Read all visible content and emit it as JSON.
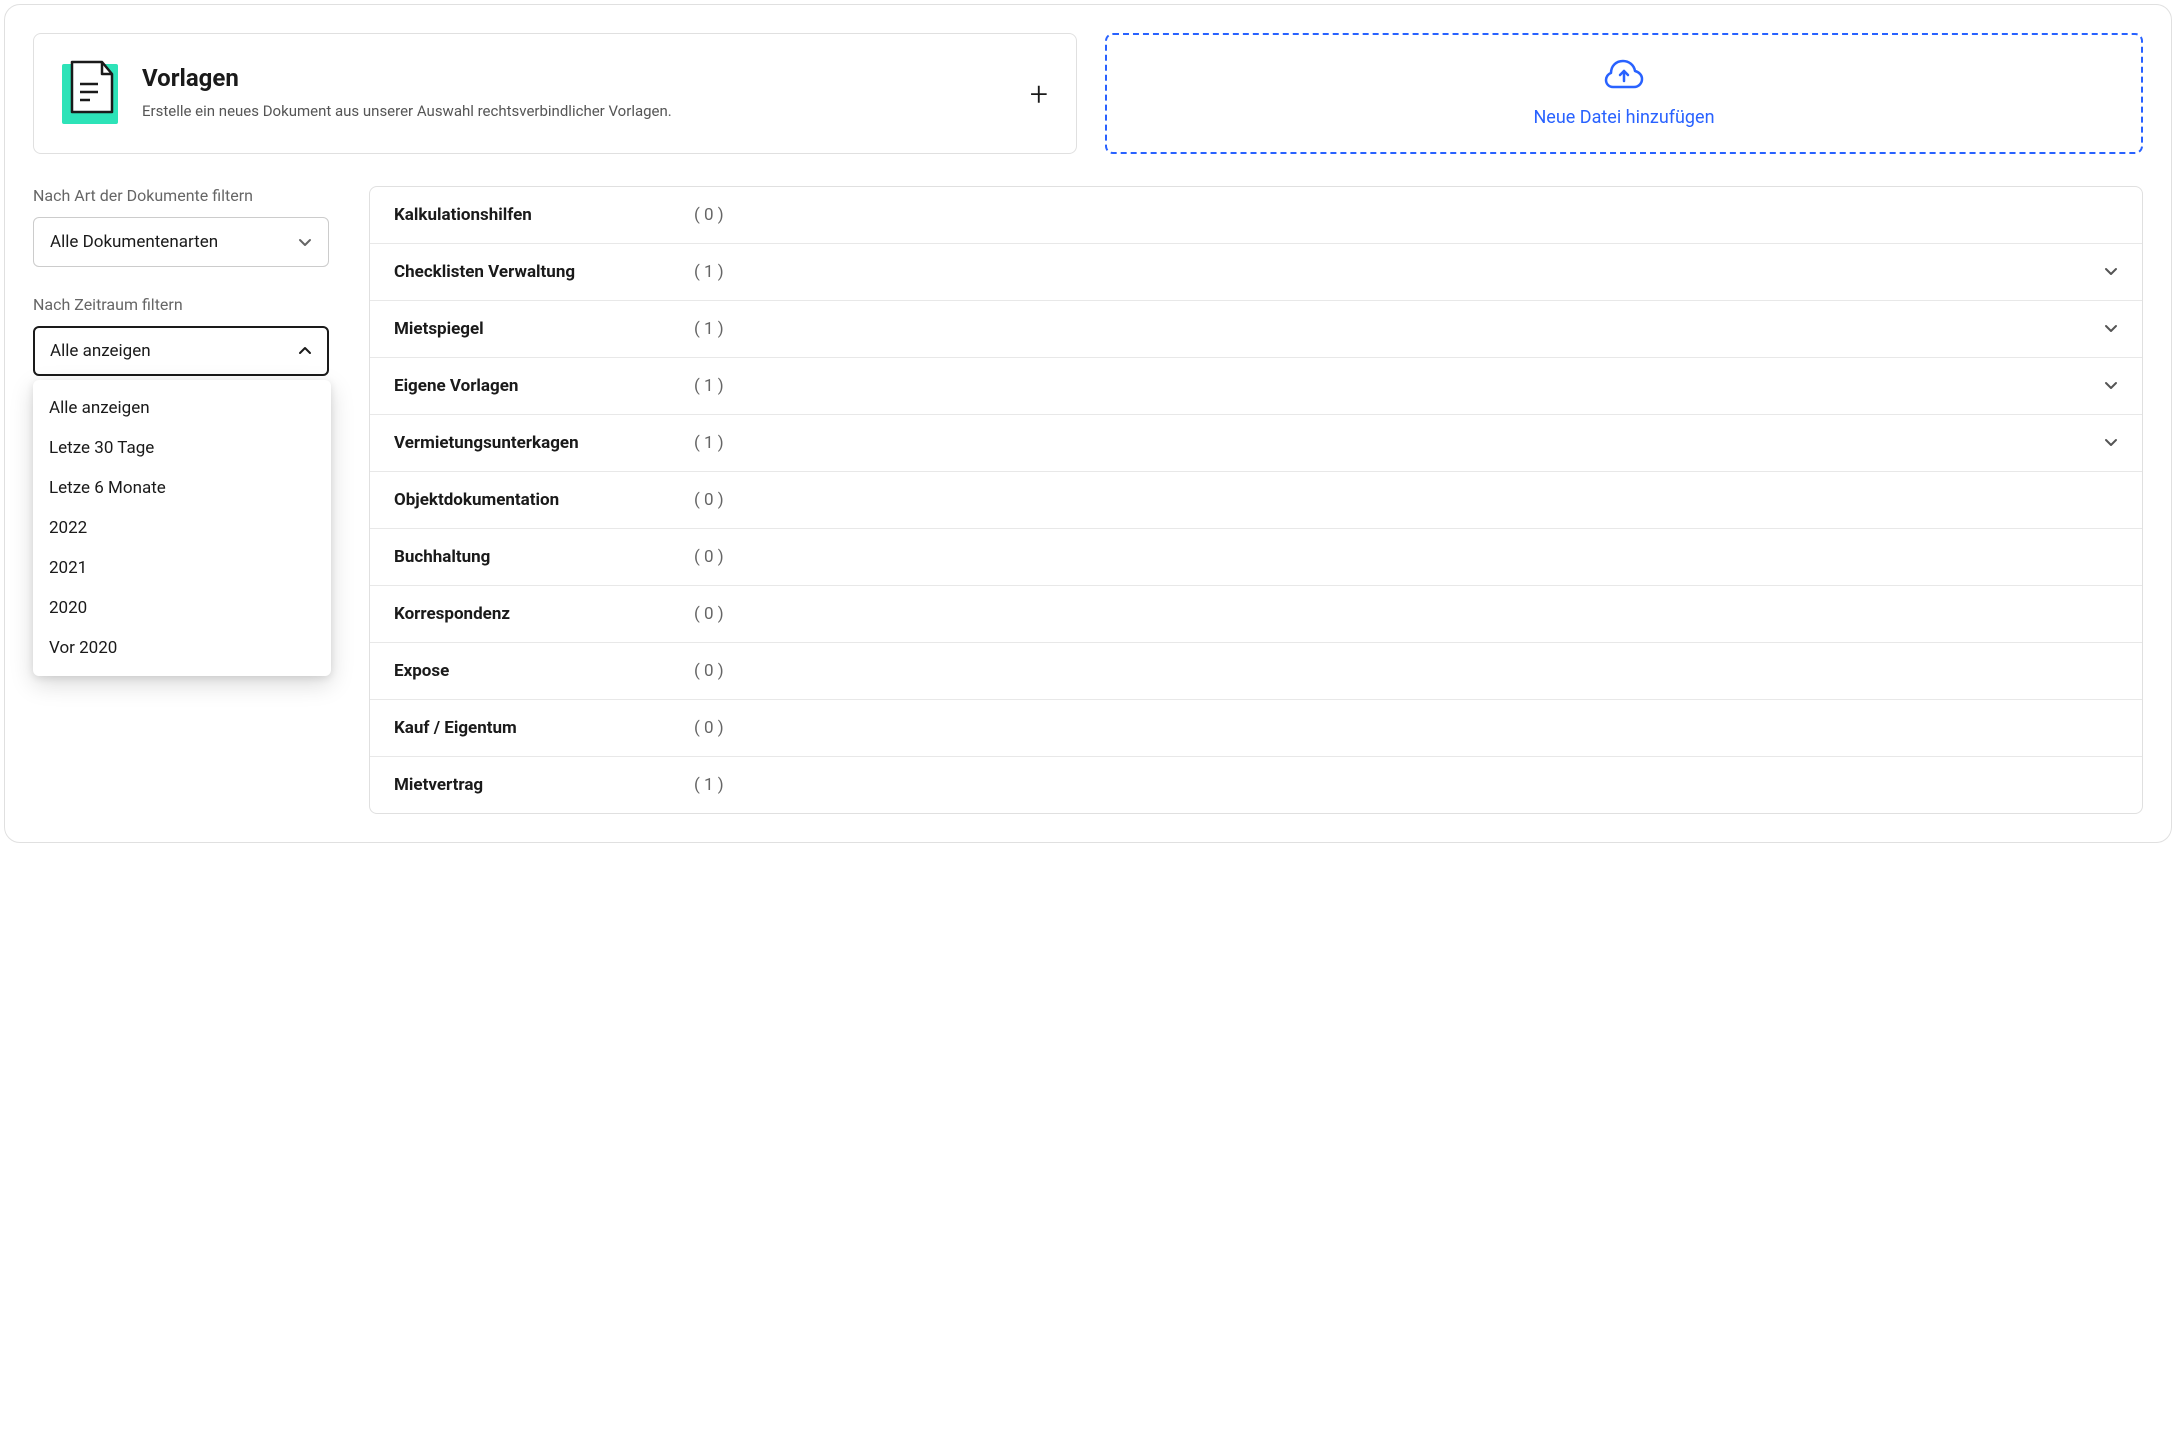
{
  "templates": {
    "title": "Vorlagen",
    "description": "Erstelle ein neues Dokument aus unserer Auswahl rechtsverbindlicher Vorlagen."
  },
  "upload": {
    "label": "Neue Datei hinzufügen"
  },
  "filters": {
    "doctype": {
      "label": "Nach Art der Dokumente filtern",
      "selected": "Alle Dokumentenarten"
    },
    "period": {
      "label": "Nach Zeitraum filtern",
      "selected": "Alle anzeigen",
      "options": [
        "Alle anzeigen",
        "Letze 30 Tage",
        "Letze 6 Monate",
        "2022",
        "2021",
        "2020",
        "Vor 2020"
      ]
    }
  },
  "categories": [
    {
      "name": "Kalkulationshilfen",
      "count": "( 0 )",
      "expandable": false
    },
    {
      "name": "Checklisten Verwaltung",
      "count": "( 1 )",
      "expandable": true
    },
    {
      "name": "Mietspiegel",
      "count": "( 1 )",
      "expandable": true
    },
    {
      "name": "Eigene Vorlagen",
      "count": "( 1 )",
      "expandable": true
    },
    {
      "name": "Vermietungsunterkagen",
      "count": "( 1 )",
      "expandable": true
    },
    {
      "name": "Objektdokumentation",
      "count": "( 0 )",
      "expandable": false
    },
    {
      "name": "Buchhaltung",
      "count": "( 0 )",
      "expandable": false
    },
    {
      "name": "Korrespondenz",
      "count": "( 0 )",
      "expandable": false
    },
    {
      "name": "Expose",
      "count": "( 0 )",
      "expandable": false
    },
    {
      "name": "Kauf / Eigentum",
      "count": "( 0 )",
      "expandable": false
    },
    {
      "name": "Mietvertrag",
      "count": "( 1 )",
      "expandable": false
    }
  ]
}
